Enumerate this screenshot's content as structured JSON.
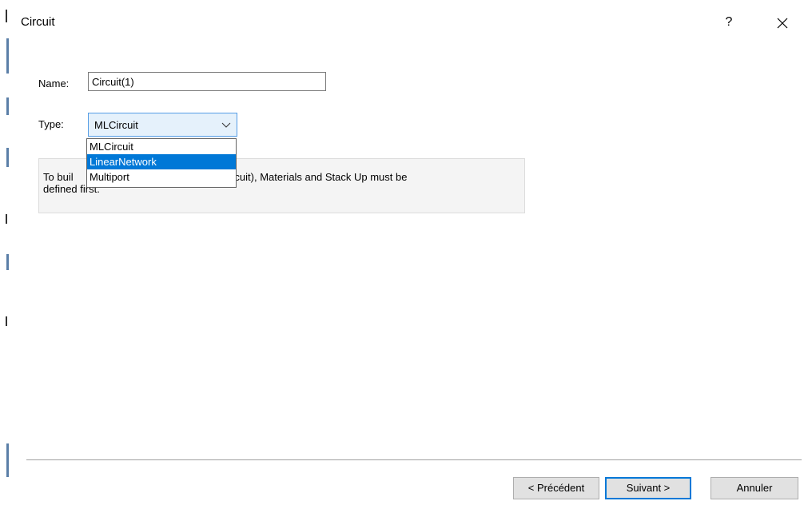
{
  "window": {
    "title": "Circuit",
    "help_label": "?"
  },
  "form": {
    "name_label": "Name:",
    "name_value": "Circuit(1)",
    "type_label": "Type:",
    "type_selected": "MLCircuit",
    "type_options": [
      "MLCircuit",
      "LinearNetwork",
      "Multiport"
    ],
    "highlighted_option": "LinearNetwork"
  },
  "info": {
    "line1_visible_start": "To buil",
    "line1_visible_end": "LCircuit), Materials and Stack Up must be",
    "line2": "defined first."
  },
  "buttons": {
    "previous": "< Précédent",
    "next": "Suivant >",
    "cancel": "Annuler"
  },
  "colors": {
    "accent": "#0078d7",
    "selected_bg": "#e5f1fb",
    "select_border": "#569de5"
  },
  "icons": {
    "close": "close-icon",
    "chevron": "chevron-down-icon"
  }
}
